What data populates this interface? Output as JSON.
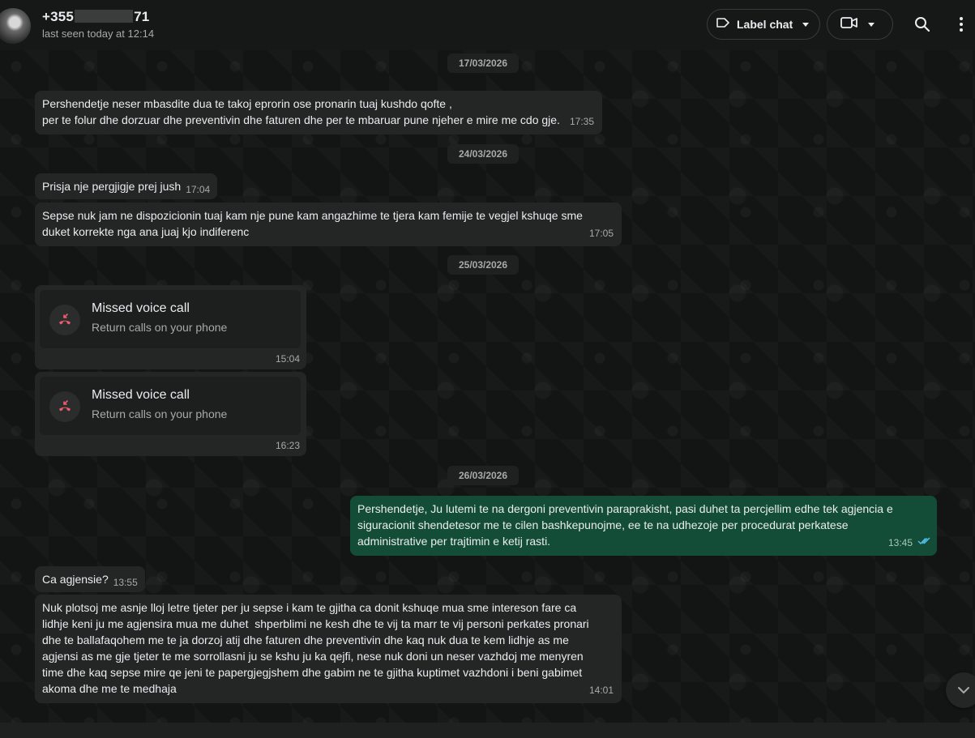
{
  "header": {
    "contact_name_prefix": "+355",
    "contact_name_suffix": "71",
    "status": "last seen today at 12:14",
    "label_chat": "Label chat"
  },
  "dates": {
    "d1": "17/03/2026",
    "d2": "24/03/2026",
    "d3": "25/03/2026",
    "d4": "26/03/2026"
  },
  "messages": {
    "m1": {
      "text": "Pershendetje neser mbasdite dua te takoj eprorin ose pronarin tuaj kushdo qofte ,\nper te folur dhe dorzuar dhe preventivin dhe faturen dhe per te mbaruar pune njeher e mire me cdo gje.",
      "time": "17:35"
    },
    "m2": {
      "text": "Prisja nje pergjigje prej jush",
      "time": "17:04"
    },
    "m3": {
      "text": "Sepse nuk jam ne dispozicionin tuaj kam nje pune kam angazhime te tjera kam femije te vegjel kshuqe sme\nduket korrekte nga ana juaj kjo indiferenc",
      "time": "17:05"
    },
    "call1": {
      "title": "Missed voice call",
      "subtitle": "Return calls on your phone",
      "time": "15:04"
    },
    "call2": {
      "title": "Missed voice call",
      "subtitle": "Return calls on your phone",
      "time": "16:23"
    },
    "m4": {
      "text": "Pershendetje, Ju lutemi te na dergoni preventivin paraprakisht, pasi duhet ta percjellim edhe tek agjencia e\nsiguracionit shendetesor me te cilen bashkepunojme, ee te na udhezoje per procedurat perkatese\nadministrative per trajtimin e ketij rasti.",
      "time": "13:45"
    },
    "m5": {
      "text": "Ca agjensie?",
      "time": "13:55"
    },
    "m6": {
      "text": "Nuk plotsoj me asnje lloj letre tjeter per ju sepse i kam te gjitha ca donit kshuqe mua sme intereson fare ca\nlidhje keni ju me agjensira mua me duhet  shperblimi ne kesh dhe te vij ta marr te vij personi perkates pronari\ndhe te ballafaqohem me te ja dorzoj atij dhe faturen dhe preventivin dhe kaq nuk dua te kem lidhje as me\nagjensi as me gje tjeter te me sorrollasni ju se kshu ju ka qejfi, nese nuk doni un neser vazhdoj me menyren\ntime dhe kaq sepse mire qe jeni te papergjegjshem dhe gabim ne te gjitha kuptimet vazhdoni i beni gabimet\nakoma dhe me te medhaja",
      "time": "14:01"
    }
  },
  "colors": {
    "outgoing_bubble": "#144d37",
    "incoming_bubble": "#242626",
    "missed_call_red": "#f15c6d",
    "read_ticks": "#53bdeb"
  }
}
